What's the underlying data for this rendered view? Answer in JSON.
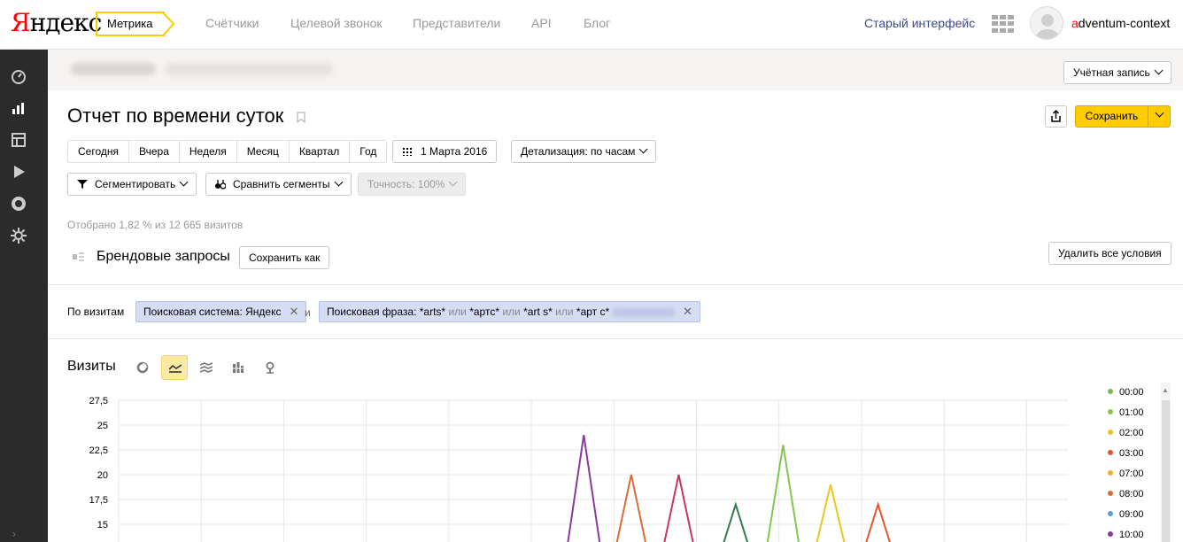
{
  "header": {
    "logo_ya": "Я",
    "logo_rest": "ндекс",
    "product": "Метрика",
    "nav": [
      "Счётчики",
      "Целевой звонок",
      "Представители",
      "API",
      "Блог"
    ],
    "old_interface": "Старый интерфейс",
    "username_first": "a",
    "username_rest": "dventum-context"
  },
  "account": {
    "button": "Учётная запись"
  },
  "report": {
    "title": "Отчет по времени суток",
    "save": "Сохранить"
  },
  "periods": [
    "Сегодня",
    "Вчера",
    "Неделя",
    "Месяц",
    "Квартал",
    "Год"
  ],
  "date": "1 Марта 2016",
  "detail": "Детализация: по часам",
  "segment_btn": "Сегментировать",
  "compare_btn": "Сравнить сегменты",
  "accuracy": "Точность: 100%",
  "selected_info": "Отобрано 1,82 % из 12 665 визитов",
  "segment": {
    "name": "Брендовые запросы",
    "save_as": "Сохранить как",
    "remove_all": "Удалить все условия"
  },
  "conditions": {
    "label": "По визитам",
    "and": "и",
    "chip1": "Поисковая система: Яндекс",
    "chip2_parts": [
      "Поисковая фраза: *arts*",
      "или",
      "*артс*",
      "или",
      "*art s*",
      "или",
      "*арт с*"
    ]
  },
  "chart_section": {
    "label": "Визиты"
  },
  "chart_data": {
    "type": "line",
    "yticks": [
      "27,5",
      "25",
      "22,5",
      "20",
      "17,5",
      "15"
    ],
    "ylim": [
      12.5,
      27.5
    ],
    "x": [
      0,
      1,
      2,
      3,
      4,
      5,
      6,
      7,
      8,
      9,
      10,
      11,
      12,
      13,
      14,
      15,
      16,
      17,
      18,
      19,
      20,
      21,
      22,
      23,
      24,
      25,
      26,
      27,
      28,
      29,
      30,
      31,
      32,
      33,
      34,
      35,
      36,
      37,
      38,
      39,
      40,
      41,
      42,
      43,
      44,
      45,
      46,
      47,
      48,
      49,
      50,
      51,
      52,
      53,
      54,
      55,
      56,
      57,
      58,
      59,
      60,
      61,
      62,
      63,
      64,
      65,
      66,
      67,
      68,
      69,
      70,
      71,
      72,
      73,
      74,
      75,
      76,
      77,
      78,
      79,
      80,
      81,
      82,
      83,
      84,
      85,
      86,
      87,
      88,
      89,
      90,
      91,
      92,
      93,
      94,
      95,
      96,
      97,
      98,
      99,
      100
    ],
    "series": [
      {
        "name": "00:00",
        "color": "#7ab55c",
        "peaks": []
      },
      {
        "name": "01:00",
        "color": "#84c552",
        "peaks": [
          [
            70,
            23
          ]
        ]
      },
      {
        "name": "02:00",
        "color": "#f0c419",
        "peaks": [
          [
            75,
            19
          ]
        ]
      },
      {
        "name": "03:00",
        "color": "#e5542c",
        "peaks": [
          [
            80,
            17
          ]
        ]
      },
      {
        "name": "07:00",
        "color": "#f0b020",
        "peaks": []
      },
      {
        "name": "08:00",
        "color": "#d86d3b",
        "peaks": [
          [
            54,
            20
          ]
        ]
      },
      {
        "name": "09:00",
        "color": "#5b9bd5",
        "peaks": []
      },
      {
        "name": "10:00",
        "color": "#8b3a9a",
        "peaks": [
          [
            49,
            24
          ]
        ]
      },
      {
        "name": "",
        "color": "#c8336a",
        "peaks": [
          [
            59,
            20
          ]
        ]
      },
      {
        "name": "",
        "color": "#2e7d4a",
        "peaks": [
          [
            65,
            17
          ]
        ]
      }
    ]
  },
  "colors": {
    "accent": "#ffcc00",
    "chip_bg": "#d7dcf5",
    "sidebar": "#2b2b2b"
  }
}
